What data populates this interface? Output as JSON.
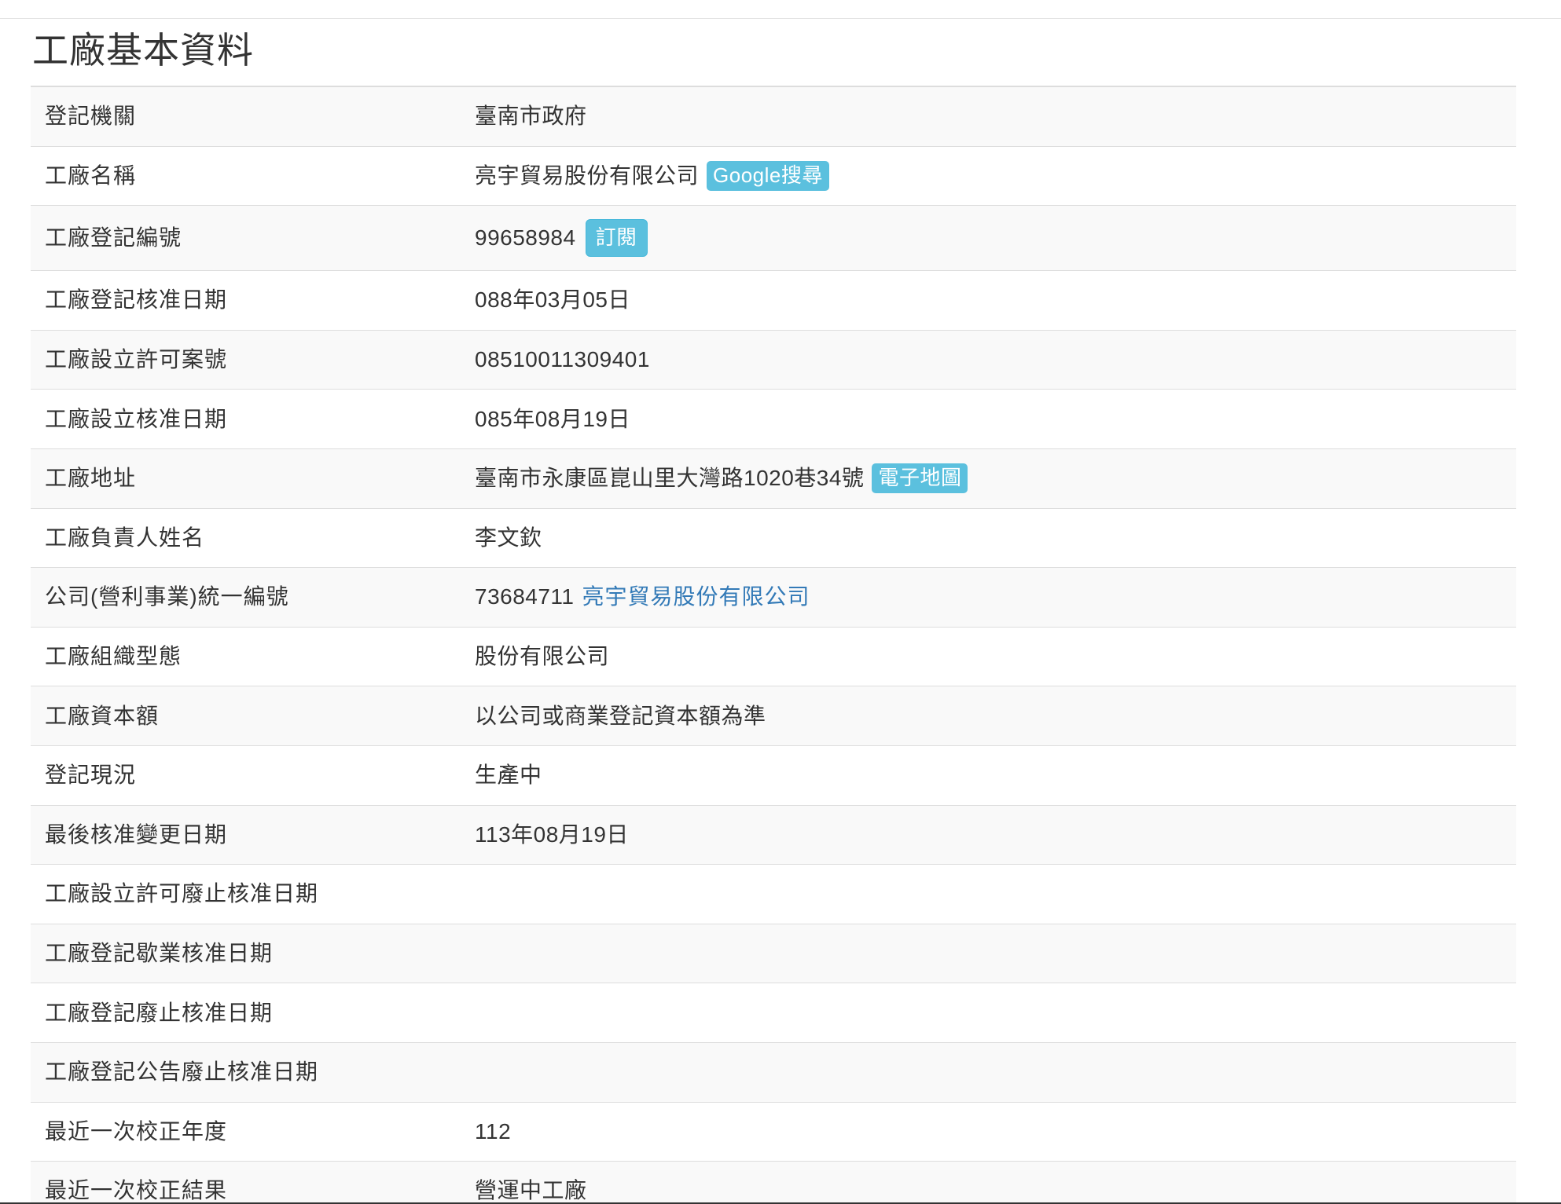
{
  "page": {
    "title": "工廠基本資料"
  },
  "rows": [
    {
      "label": "登記機關",
      "value": "臺南市政府"
    },
    {
      "label": "工廠名稱",
      "value": "亮宇貿易股份有限公司",
      "badge": "Google搜尋"
    },
    {
      "label": "工廠登記編號",
      "value": "99658984",
      "button": "訂閱"
    },
    {
      "label": "工廠登記核准日期",
      "value": "088年03月05日"
    },
    {
      "label": "工廠設立許可案號",
      "value": "08510011309401"
    },
    {
      "label": "工廠設立核准日期",
      "value": "085年08月19日"
    },
    {
      "label": "工廠地址",
      "value": "臺南市永康區崑山里大灣路1020巷34號",
      "badge": "電子地圖"
    },
    {
      "label": "工廠負責人姓名",
      "value": "李文欽"
    },
    {
      "label": "公司(營利事業)統一編號",
      "value": "73684711",
      "link": "亮宇貿易股份有限公司"
    },
    {
      "label": "工廠組織型態",
      "value": "股份有限公司"
    },
    {
      "label": "工廠資本額",
      "value": "以公司或商業登記資本額為準"
    },
    {
      "label": "登記現況",
      "value": "生產中"
    },
    {
      "label": "最後核准變更日期",
      "value": "113年08月19日"
    },
    {
      "label": "工廠設立許可廢止核准日期",
      "value": ""
    },
    {
      "label": "工廠登記歇業核准日期",
      "value": ""
    },
    {
      "label": "工廠登記廢止核准日期",
      "value": ""
    },
    {
      "label": "工廠登記公告廢止核准日期",
      "value": ""
    },
    {
      "label": "最近一次校正年度",
      "value": "112"
    },
    {
      "label": "最近一次校正結果",
      "value": "營運中工廠"
    }
  ],
  "colors": {
    "badge": "#5bc0de",
    "link": "#337ab7",
    "stripe": "#f9f9f9",
    "border": "#dddddd"
  }
}
